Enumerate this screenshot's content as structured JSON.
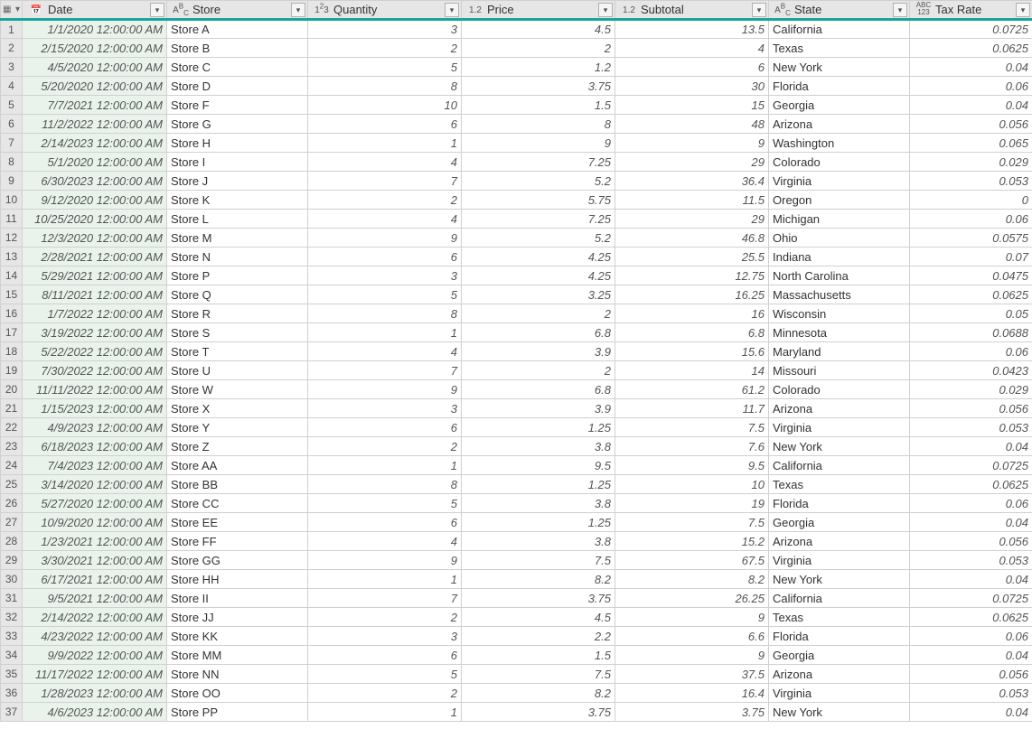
{
  "columns": [
    {
      "name": "Date",
      "type_icon": "date",
      "width": 160,
      "align": "idx"
    },
    {
      "name": "Store",
      "type_icon": "text",
      "width": 156,
      "align": "txt"
    },
    {
      "name": "Quantity",
      "type_icon": "int",
      "width": 170,
      "align": "num"
    },
    {
      "name": "Price",
      "type_icon": "dec",
      "width": 170,
      "align": "num"
    },
    {
      "name": "Subtotal",
      "type_icon": "dec",
      "width": 170,
      "align": "num"
    },
    {
      "name": "State",
      "type_icon": "text",
      "width": 156,
      "align": "txt"
    },
    {
      "name": "Tax Rate",
      "type_icon": "any",
      "width": 136,
      "align": "num"
    }
  ],
  "type_icons": {
    "date": "📅",
    "text": "AᴮC",
    "int": "1²3",
    "dec": "1.2",
    "any": "ABC123"
  },
  "rows": [
    [
      "1/1/2020 12:00:00 AM",
      "Store A",
      "3",
      "4.5",
      "13.5",
      "California",
      "0.0725"
    ],
    [
      "2/15/2020 12:00:00 AM",
      "Store B",
      "2",
      "2",
      "4",
      "Texas",
      "0.0625"
    ],
    [
      "4/5/2020 12:00:00 AM",
      "Store C",
      "5",
      "1.2",
      "6",
      "New York",
      "0.04"
    ],
    [
      "5/20/2020 12:00:00 AM",
      "Store D",
      "8",
      "3.75",
      "30",
      "Florida",
      "0.06"
    ],
    [
      "7/7/2021 12:00:00 AM",
      "Store F",
      "10",
      "1.5",
      "15",
      "Georgia",
      "0.04"
    ],
    [
      "11/2/2022 12:00:00 AM",
      "Store G",
      "6",
      "8",
      "48",
      "Arizona",
      "0.056"
    ],
    [
      "2/14/2023 12:00:00 AM",
      "Store H",
      "1",
      "9",
      "9",
      "Washington",
      "0.065"
    ],
    [
      "5/1/2020 12:00:00 AM",
      "Store I",
      "4",
      "7.25",
      "29",
      "Colorado",
      "0.029"
    ],
    [
      "6/30/2023 12:00:00 AM",
      "Store J",
      "7",
      "5.2",
      "36.4",
      "Virginia",
      "0.053"
    ],
    [
      "9/12/2020 12:00:00 AM",
      "Store K",
      "2",
      "5.75",
      "11.5",
      "Oregon",
      "0"
    ],
    [
      "10/25/2020 12:00:00 AM",
      "Store L",
      "4",
      "7.25",
      "29",
      "Michigan",
      "0.06"
    ],
    [
      "12/3/2020 12:00:00 AM",
      "Store M",
      "9",
      "5.2",
      "46.8",
      "Ohio",
      "0.0575"
    ],
    [
      "2/28/2021 12:00:00 AM",
      "Store N",
      "6",
      "4.25",
      "25.5",
      "Indiana",
      "0.07"
    ],
    [
      "5/29/2021 12:00:00 AM",
      "Store P",
      "3",
      "4.25",
      "12.75",
      "North Carolina",
      "0.0475"
    ],
    [
      "8/11/2021 12:00:00 AM",
      "Store Q",
      "5",
      "3.25",
      "16.25",
      "Massachusetts",
      "0.0625"
    ],
    [
      "1/7/2022 12:00:00 AM",
      "Store R",
      "8",
      "2",
      "16",
      "Wisconsin",
      "0.05"
    ],
    [
      "3/19/2022 12:00:00 AM",
      "Store S",
      "1",
      "6.8",
      "6.8",
      "Minnesota",
      "0.0688"
    ],
    [
      "5/22/2022 12:00:00 AM",
      "Store T",
      "4",
      "3.9",
      "15.6",
      "Maryland",
      "0.06"
    ],
    [
      "7/30/2022 12:00:00 AM",
      "Store U",
      "7",
      "2",
      "14",
      "Missouri",
      "0.0423"
    ],
    [
      "11/11/2022 12:00:00 AM",
      "Store W",
      "9",
      "6.8",
      "61.2",
      "Colorado",
      "0.029"
    ],
    [
      "1/15/2023 12:00:00 AM",
      "Store X",
      "3",
      "3.9",
      "11.7",
      "Arizona",
      "0.056"
    ],
    [
      "4/9/2023 12:00:00 AM",
      "Store Y",
      "6",
      "1.25",
      "7.5",
      "Virginia",
      "0.053"
    ],
    [
      "6/18/2023 12:00:00 AM",
      "Store Z",
      "2",
      "3.8",
      "7.6",
      "New York",
      "0.04"
    ],
    [
      "7/4/2023 12:00:00 AM",
      "Store AA",
      "1",
      "9.5",
      "9.5",
      "California",
      "0.0725"
    ],
    [
      "3/14/2020 12:00:00 AM",
      "Store BB",
      "8",
      "1.25",
      "10",
      "Texas",
      "0.0625"
    ],
    [
      "5/27/2020 12:00:00 AM",
      "Store CC",
      "5",
      "3.8",
      "19",
      "Florida",
      "0.06"
    ],
    [
      "10/9/2020 12:00:00 AM",
      "Store EE",
      "6",
      "1.25",
      "7.5",
      "Georgia",
      "0.04"
    ],
    [
      "1/23/2021 12:00:00 AM",
      "Store FF",
      "4",
      "3.8",
      "15.2",
      "Arizona",
      "0.056"
    ],
    [
      "3/30/2021 12:00:00 AM",
      "Store GG",
      "9",
      "7.5",
      "67.5",
      "Virginia",
      "0.053"
    ],
    [
      "6/17/2021 12:00:00 AM",
      "Store HH",
      "1",
      "8.2",
      "8.2",
      "New York",
      "0.04"
    ],
    [
      "9/5/2021 12:00:00 AM",
      "Store II",
      "7",
      "3.75",
      "26.25",
      "California",
      "0.0725"
    ],
    [
      "2/14/2022 12:00:00 AM",
      "Store JJ",
      "2",
      "4.5",
      "9",
      "Texas",
      "0.0625"
    ],
    [
      "4/23/2022 12:00:00 AM",
      "Store KK",
      "3",
      "2.2",
      "6.6",
      "Florida",
      "0.06"
    ],
    [
      "9/9/2022 12:00:00 AM",
      "Store MM",
      "6",
      "1.5",
      "9",
      "Georgia",
      "0.04"
    ],
    [
      "11/17/2022 12:00:00 AM",
      "Store NN",
      "5",
      "7.5",
      "37.5",
      "Arizona",
      "0.056"
    ],
    [
      "1/28/2023 12:00:00 AM",
      "Store OO",
      "2",
      "8.2",
      "16.4",
      "Virginia",
      "0.053"
    ],
    [
      "4/6/2023 12:00:00 AM",
      "Store PP",
      "1",
      "3.75",
      "3.75",
      "New York",
      "0.04"
    ]
  ]
}
